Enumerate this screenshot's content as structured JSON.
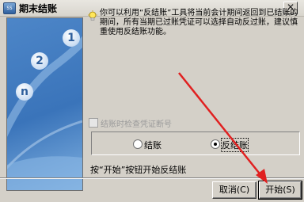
{
  "window": {
    "title": "期末结账",
    "icon_label": "SS",
    "close_glyph": "✕"
  },
  "side_panel": {
    "numbers": [
      "1",
      "2",
      "n"
    ]
  },
  "description": "你可以利用“反结账”工具将当前会计期间返回到已结账的期间，所有当期已过账凭证可以选择自动反过账，建议慎重使用反结账功能。",
  "options": {
    "checkbox_label": "结账时检查凭证断号",
    "checkbox_checked": false,
    "checkbox_enabled": false,
    "radio_close": "结账",
    "radio_reverse": "反结账",
    "selected": "反结账"
  },
  "status_text": "按“开始”按钮开始反结账",
  "buttons": {
    "cancel": "取消(C)",
    "start": "开始(S)"
  },
  "colors": {
    "panel_blue": "#3a74ba",
    "annotation_red": "#e02020",
    "dialog_gray": "#d4d0c8"
  }
}
